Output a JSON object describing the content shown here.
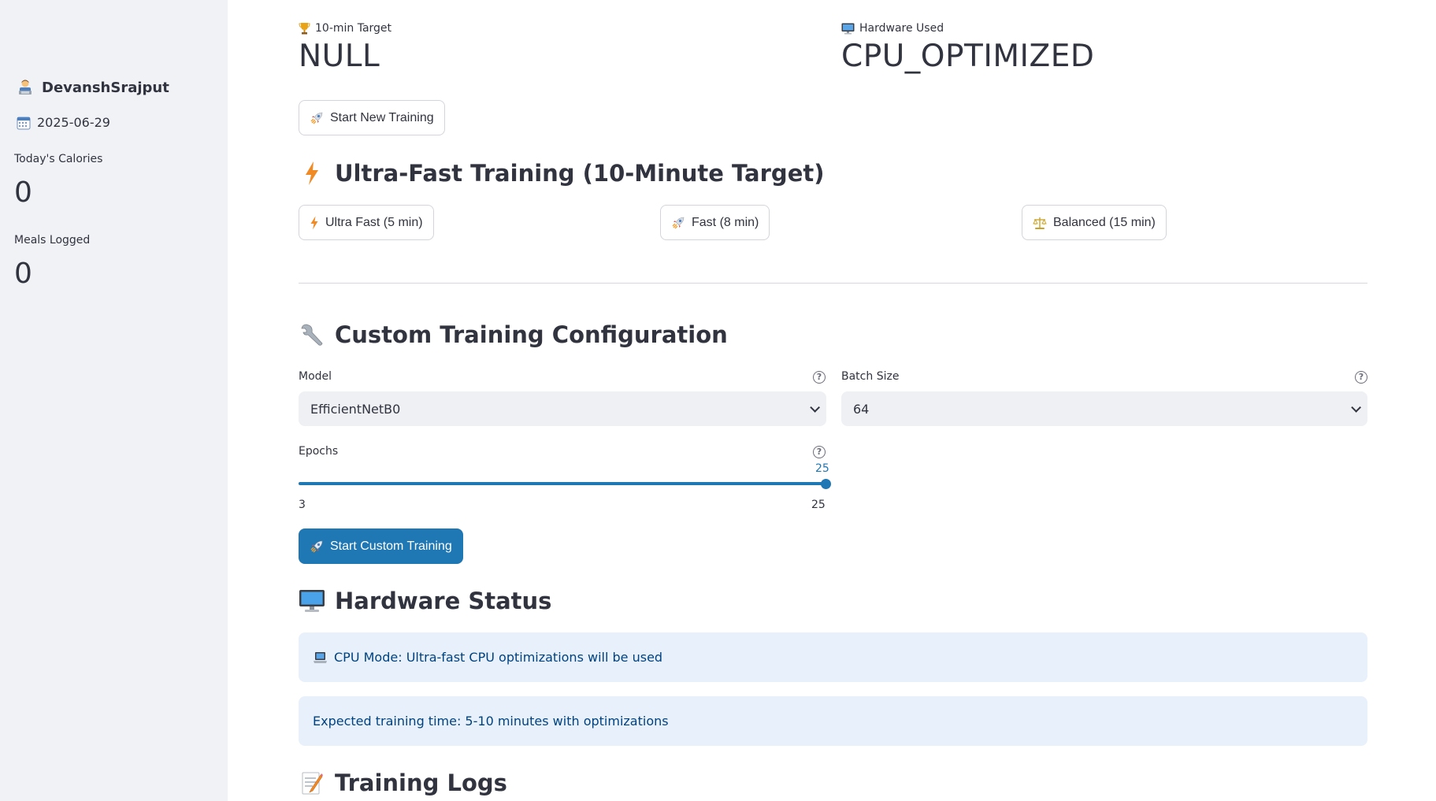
{
  "sidebar": {
    "username": "DevanshSrajput",
    "date": "2025-06-29",
    "metrics": [
      {
        "label": "Today's Calories",
        "value": "0"
      },
      {
        "label": "Meals Logged",
        "value": "0"
      }
    ]
  },
  "top_metrics": [
    {
      "label": "10-min Target",
      "value": "NULL",
      "icon": "trophy-icon"
    },
    {
      "label": "Hardware Used",
      "value": "CPU_OPTIMIZED",
      "icon": "monitor-icon"
    }
  ],
  "start_new_training": {
    "label": "Start New Training",
    "icon": "rocket-icon"
  },
  "ultra_fast_section": {
    "title": "Ultra-Fast Training (10-Minute Target)",
    "icon": "lightning-icon",
    "presets": [
      {
        "label": "Ultra Fast (5 min)",
        "icon": "lightning-icon"
      },
      {
        "label": "Fast (8 min)",
        "icon": "rocket-icon"
      },
      {
        "label": "Balanced (15 min)",
        "icon": "scales-icon"
      }
    ]
  },
  "custom_section": {
    "title": "Custom Training Configuration",
    "icon": "wrench-icon",
    "model": {
      "label": "Model",
      "value": "EfficientNetB0"
    },
    "batch_size": {
      "label": "Batch Size",
      "value": "64"
    },
    "epochs": {
      "label": "Epochs",
      "value": "25",
      "min": "3",
      "max": "25",
      "fraction": 1.0
    },
    "start_button": {
      "label": "Start Custom Training",
      "icon": "rocket-icon"
    }
  },
  "hardware_section": {
    "title": "Hardware Status",
    "icon": "desktop-icon",
    "messages": [
      {
        "text": "CPU Mode: Ultra-fast CPU optimizations will be used",
        "icon": "laptop-icon"
      },
      {
        "text": "Expected training time: 5-10 minutes with optimizations"
      }
    ]
  },
  "logs_section": {
    "title": "Training Logs",
    "icon": "memo-icon"
  },
  "colors": {
    "primary": "#1f77b4",
    "sidebar_bg": "#f0f2f6",
    "info_bg": "#e8f1fb",
    "info_text": "#004280"
  }
}
